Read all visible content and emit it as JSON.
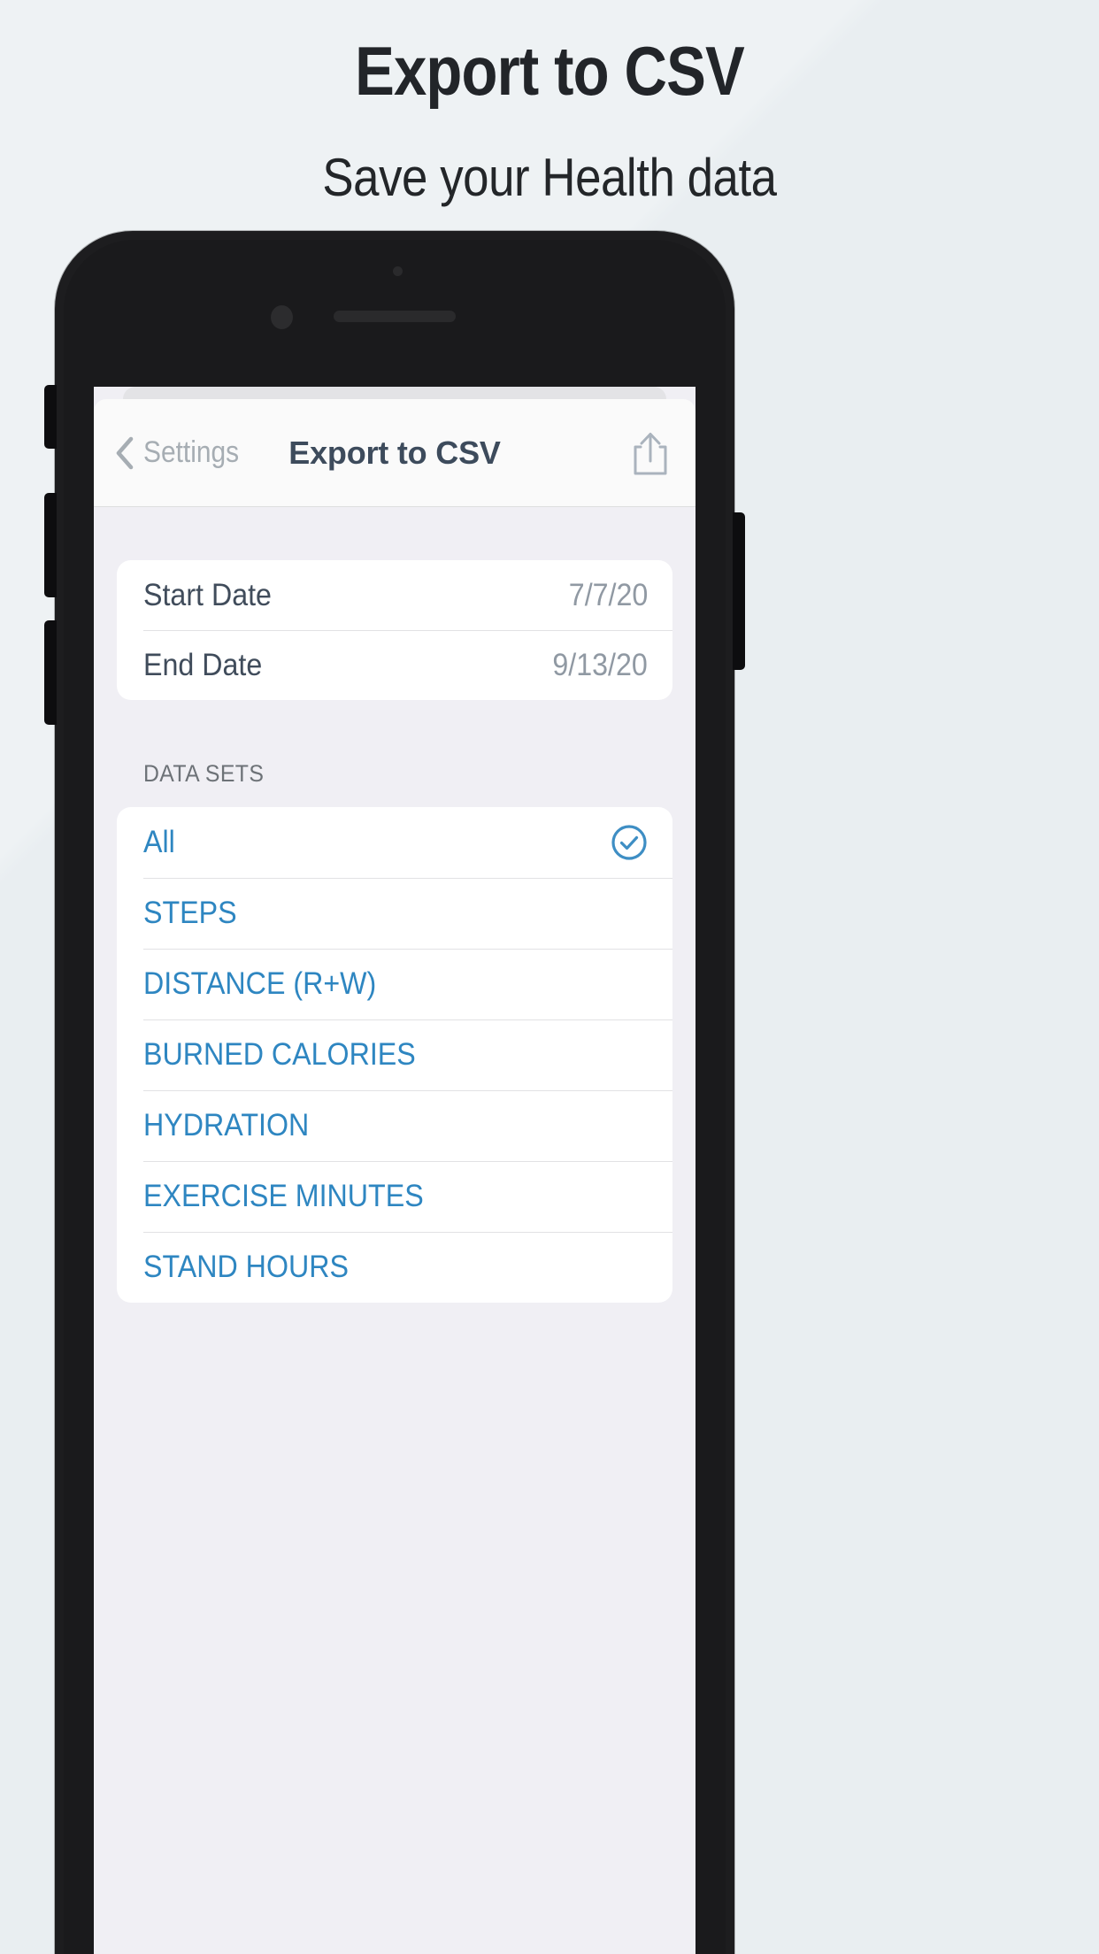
{
  "promo": {
    "headline": "Export to CSV",
    "subhead": "Save your Health data"
  },
  "device": {
    "speaker_icon": "earpiece-speaker",
    "camera_icon": "front-camera",
    "sensor_icon": "proximity-sensor",
    "buttons": [
      "mute-switch",
      "volume-up",
      "volume-down",
      "power"
    ]
  },
  "navbar": {
    "back_label": "Settings",
    "back_icon": "chevron-left-icon",
    "title": "Export to CSV",
    "share_icon": "share-icon"
  },
  "dates": {
    "rows": [
      {
        "label": "Start Date",
        "value": "7/7/20"
      },
      {
        "label": "End Date",
        "value": "9/13/20"
      }
    ]
  },
  "datasets": {
    "section_title": "DATA SETS",
    "items": [
      {
        "label": "All",
        "selected": true,
        "check_icon": "check-circle-icon"
      },
      {
        "label": "STEPS",
        "selected": false
      },
      {
        "label": "DISTANCE (R+W)",
        "selected": false
      },
      {
        "label": "BURNED CALORIES",
        "selected": false
      },
      {
        "label": "HYDRATION",
        "selected": false
      },
      {
        "label": "EXERCISE MINUTES",
        "selected": false
      },
      {
        "label": "STAND HOURS",
        "selected": false
      }
    ]
  },
  "colors": {
    "page_background": "#eaeff2",
    "headline": "#222529",
    "phone_body": "#1d1d1f",
    "navbar_background": "#fafafa",
    "nav_title": "#3d4b5c",
    "nav_back_label": "#a6adb3",
    "screen_background": "#f0eff4",
    "card_background": "#ffffff",
    "row_label": "#404c5b",
    "row_value": "#9099a3",
    "section_title": "#6d7277",
    "accent_blue": "#2e86c1",
    "separator": "#e2e2e4"
  }
}
